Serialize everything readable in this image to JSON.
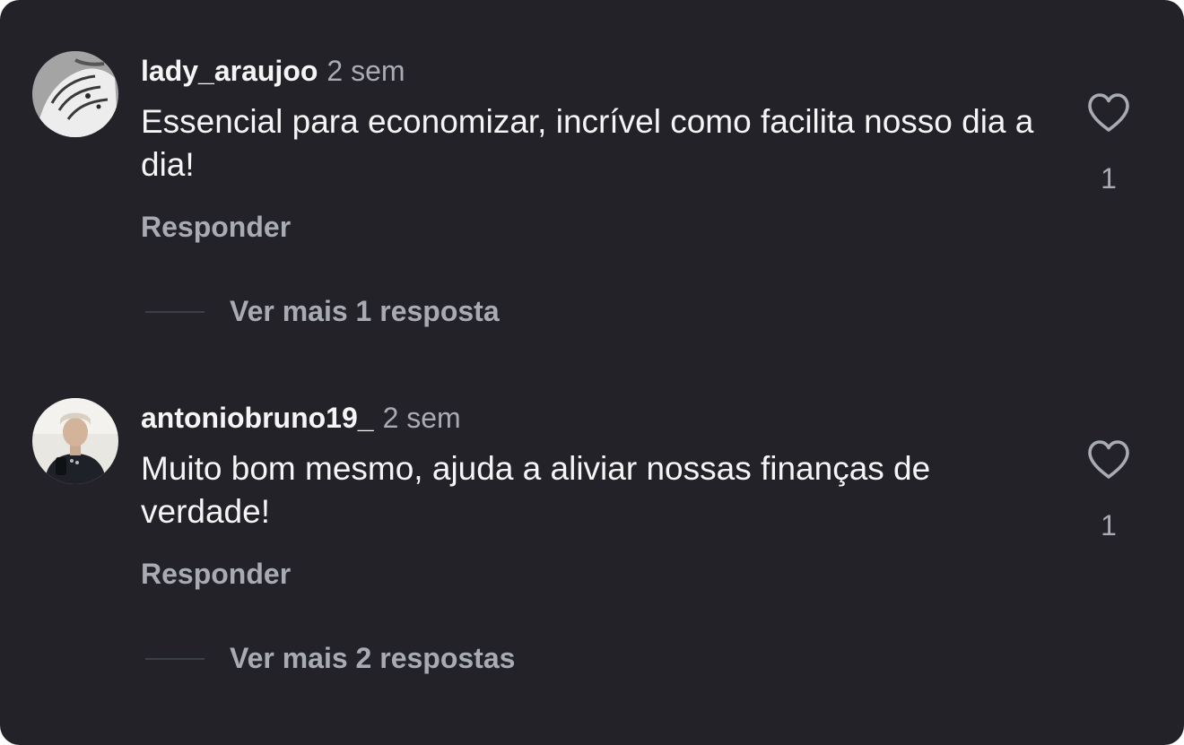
{
  "comments": [
    {
      "username": "lady_araujoo",
      "time": "2 sem",
      "text": "Essencial para economizar, incrível como facilita nosso dia a dia!",
      "reply_label": "Responder",
      "more_replies_label": "Ver mais 1 resposta",
      "like_count": "1",
      "avatar_icon": "avatar-photo-hands",
      "like_icon": "heart-outline-icon"
    },
    {
      "username": "antoniobruno19_",
      "time": "2 sem",
      "text": "Muito bom mesmo, ajuda a aliviar nossas finanças de verdade!",
      "reply_label": "Responder",
      "more_replies_label": "Ver mais 2 respostas",
      "like_count": "1",
      "avatar_icon": "avatar-photo-person",
      "like_icon": "heart-outline-icon"
    }
  ],
  "colors": {
    "background": "#222228",
    "primary_text": "#f5f5f5",
    "secondary_text": "#a8acb2",
    "divider": "#3a3f48"
  }
}
